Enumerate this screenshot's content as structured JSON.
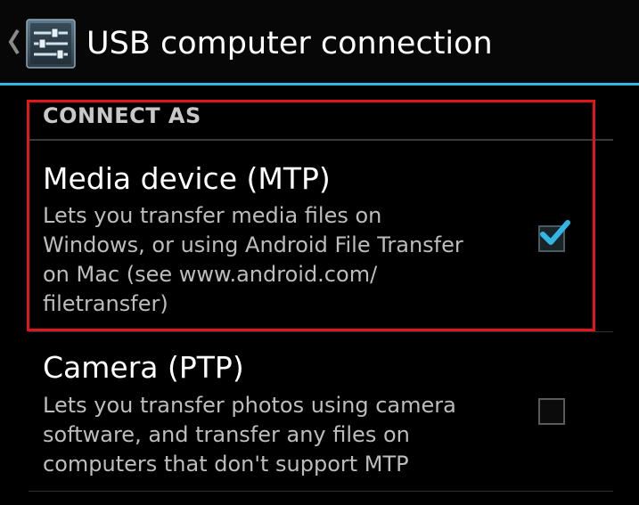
{
  "action_bar": {
    "title": "USB computer connection",
    "accent_color": "#33b5e5",
    "up_icon": "chevron-left-icon",
    "app_icon": "settings-sliders-icon"
  },
  "category": {
    "label": "CONNECT AS"
  },
  "options": [
    {
      "title": "Media device (MTP)",
      "summary_lines": [
        "Lets you transfer media files on",
        "Windows, or using Android File Transfer",
        "on Mac (see www.android.com/",
        "filetransfer)"
      ],
      "checked": true
    },
    {
      "title": "Camera (PTP)",
      "summary_lines": [
        "Lets you transfer photos using camera",
        "software, and transfer any files on",
        "computers that don't support MTP"
      ],
      "checked": false
    }
  ],
  "highlight_color": "#e0161a"
}
